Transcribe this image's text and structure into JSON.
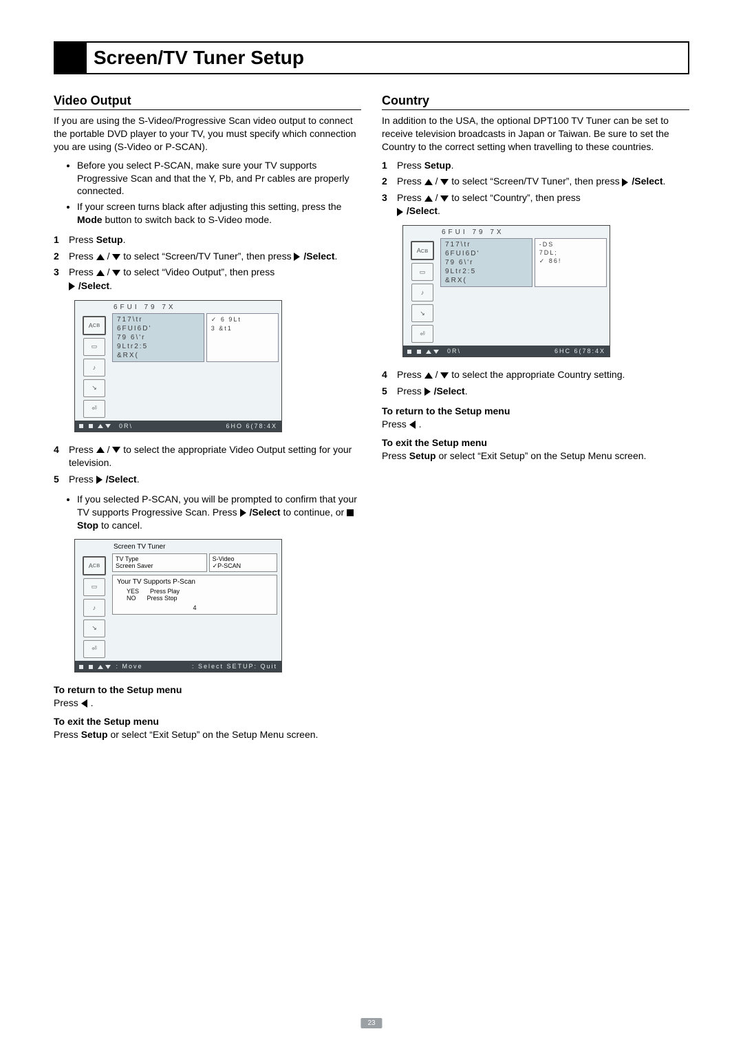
{
  "page_number": "23",
  "title": "Screen/TV Tuner Setup",
  "left": {
    "heading": "Video Output",
    "intro": "If you are using the S-Video/Progressive Scan video output to connect the portable DVD player to your TV, you must specify which connection you are using (S-Video or P-SCAN).",
    "bullets": [
      "Before you select P-SCAN, make sure your TV supports Progressive Scan and that the Y, Pb, and Pr cables are properly connected.",
      "If your screen turns black after adjusting this setting, press the Mode button to switch back to S-Video mode."
    ],
    "steps": {
      "1": {
        "pre": "Press ",
        "bold": "Setup",
        "post": "."
      },
      "2": {
        "a": "Press ",
        "b": " to select “Screen/TV Tuner”, then press ",
        "c": "/Select",
        "d": "."
      },
      "3": {
        "a": "Press ",
        "b": " to select “Video Output”, then press ",
        "c": "/Select",
        "d": "."
      },
      "4": {
        "a": "Press ",
        "b": " to select the appropriate Video Output setting for your television."
      },
      "5": {
        "a": "Press ",
        "c": "/Select",
        "d": "."
      }
    },
    "menu1": {
      "title": "6FUI 79 7X",
      "left_items": [
        "717\\tr",
        "6FUI6D'",
        "79 6\\'r",
        "9Ltr2:5",
        "&RX("
      ],
      "right_items": [
        "✓ 6 9Lt",
        "3  &t1"
      ],
      "footer_left": "0R\\",
      "footer_right": "6HO 6(78:4X"
    },
    "after4_bullets": [
      "If you selected P-SCAN, you will be prompted to confirm that your TV supports Progressive Scan. Press ▶ /Select to continue, or ■ Stop to cancel."
    ],
    "menu2": {
      "title": "Screen TV Tuner",
      "row1_left": [
        "TV Type",
        "Screen Saver"
      ],
      "row1_right": [
        "S-Video",
        "✓P-SCAN"
      ],
      "msg": "Your TV Supports P-Scan",
      "yes": "YES",
      "yes_act": "Press Play",
      "no": "NO",
      "no_act": "Press Stop",
      "num": "4",
      "footer_move": ": Move",
      "footer_sel": ": Select  SETUP: Quit"
    },
    "return_head": "To return to the Setup menu",
    "return_body_a": "Press ",
    "return_body_b": " .",
    "exit_head": "To exit the Setup menu",
    "exit_body": "Press Setup or select “Exit Setup” on the Setup Menu screen."
  },
  "right": {
    "heading": "Country",
    "intro": "In addition to the USA, the optional DPT100 TV Tuner can be set to receive television broadcasts in Japan or Taiwan. Be sure to set the Country to the correct setting when travelling to these countries.",
    "steps": {
      "1": {
        "pre": "Press ",
        "bold": "Setup",
        "post": "."
      },
      "2": {
        "a": "Press ",
        "b": " to select “Screen/TV Tuner”, then press ",
        "c": "/Select",
        "d": "."
      },
      "3": {
        "a": "Press ",
        "b": " to select “Country”, then press ",
        "c": "/Select",
        "d": "."
      },
      "4": {
        "a": "Press ",
        "b": " to select the appropriate Country setting."
      },
      "5": {
        "a": "Press ",
        "c": "/Select",
        "d": "."
      }
    },
    "menu1": {
      "title": "6FUI 79 7X",
      "left_items": [
        "717\\tr",
        "6FUI6D'",
        "79 6\\'r",
        "9Ltr2:5",
        "&RX("
      ],
      "right_items": [
        "-DS",
        "7DL;",
        "✓ 86!"
      ],
      "footer_left": "0R\\",
      "footer_right": "6HC 6(78:4X"
    },
    "return_head": "To return to the Setup menu",
    "return_body_a": "Press ",
    "return_body_b": " .",
    "exit_head": "To exit the Setup menu",
    "exit_body": "Press Setup or select “Exit Setup” on the Setup Menu screen."
  }
}
